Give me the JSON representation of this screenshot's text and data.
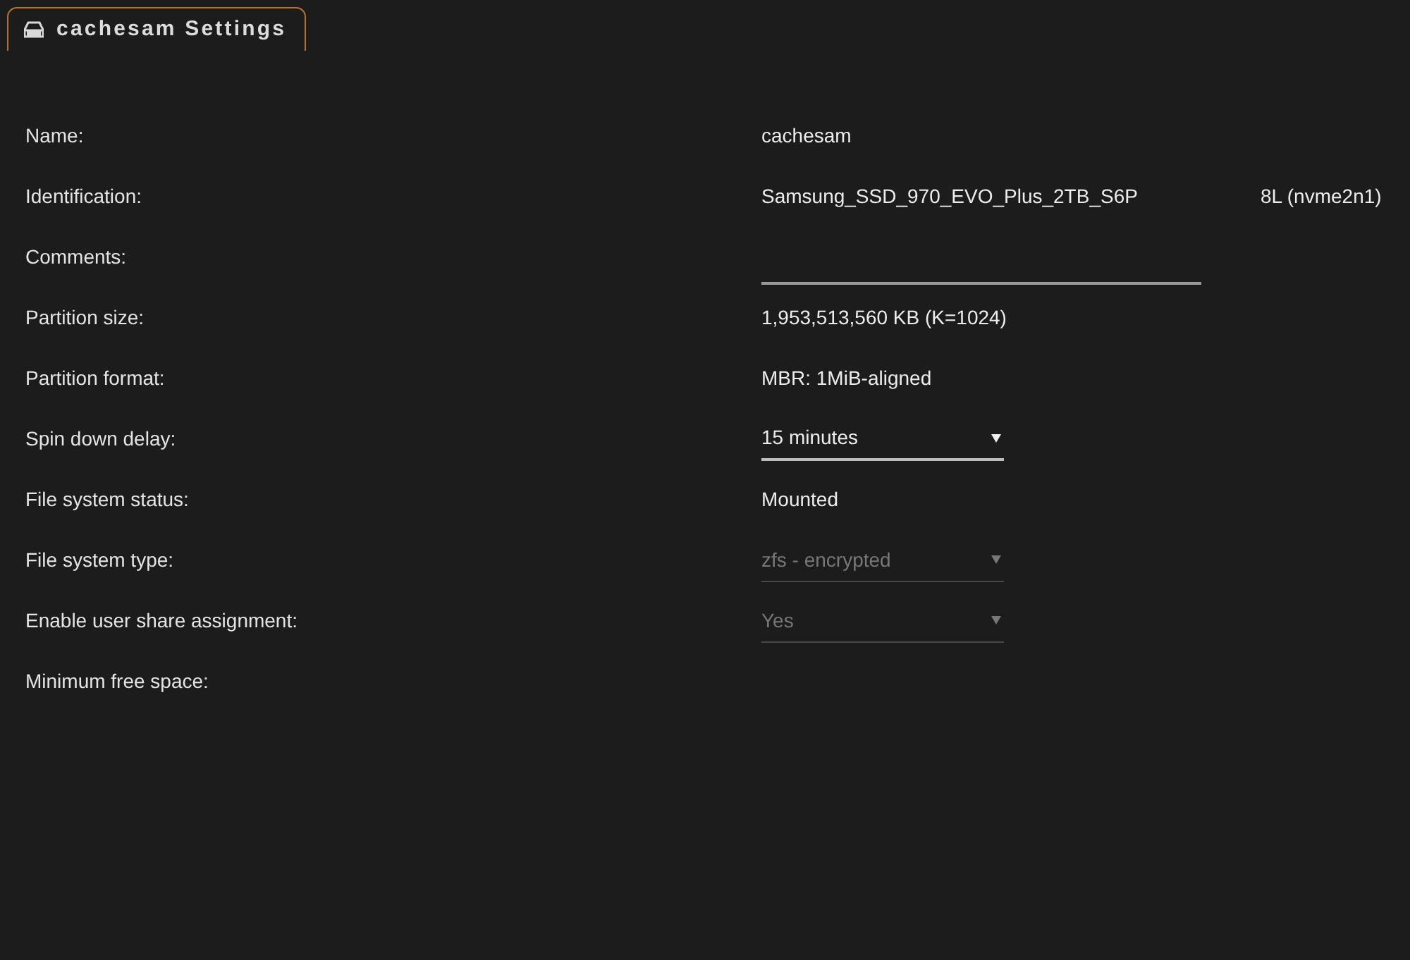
{
  "tab": {
    "title": "cachesam Settings",
    "selected": true
  },
  "fields": [
    {
      "label": "Name:",
      "kind": "text",
      "value": "cachesam"
    },
    {
      "label": "Identification:",
      "kind": "split_text",
      "parts": [
        "Samsung_SSD_970_EVO_Plus_2TB_S6P",
        "8L (nvme2n1)"
      ]
    },
    {
      "label": "Comments:",
      "kind": "input"
    },
    {
      "label": "Partition size:",
      "kind": "text",
      "value": "1,953,513,560 KB (K=1024)"
    },
    {
      "label": "Partition format:",
      "kind": "text",
      "value": "MBR: 1MiB-aligned"
    },
    {
      "label": "Spin down delay:",
      "kind": "select",
      "value": "15 minutes",
      "disabled": false
    },
    {
      "label": "File system status:",
      "kind": "text",
      "value": "Mounted"
    },
    {
      "label": "File system type:",
      "kind": "select",
      "value": "zfs - encrypted",
      "disabled": true
    },
    {
      "label": "Enable user share assignment:",
      "kind": "select",
      "value": "Yes",
      "disabled": true
    },
    {
      "label": "Minimum free space:",
      "kind": "label"
    }
  ]
}
